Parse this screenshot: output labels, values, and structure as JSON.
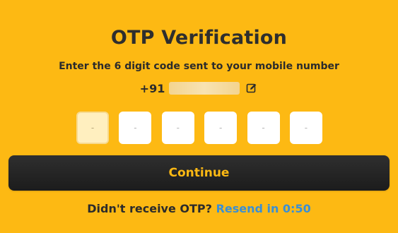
{
  "header": {
    "title": "OTP Verification",
    "subtitle": "Enter the 6 digit code sent to your mobile number"
  },
  "phone": {
    "country_code": "+91",
    "number_masked": true,
    "edit_icon": "edit-pencil-icon"
  },
  "otp": {
    "digits": [
      "-",
      "-",
      "-",
      "-",
      "-",
      "-"
    ],
    "active_index": 0
  },
  "actions": {
    "continue_label": "Continue"
  },
  "resend": {
    "prompt": "Didn't receive OTP?",
    "link_label": "Resend in 0:50"
  },
  "colors": {
    "background": "#fdb913",
    "button_bg": "#242424",
    "button_text": "#fdb913",
    "link": "#3a8fd4"
  }
}
